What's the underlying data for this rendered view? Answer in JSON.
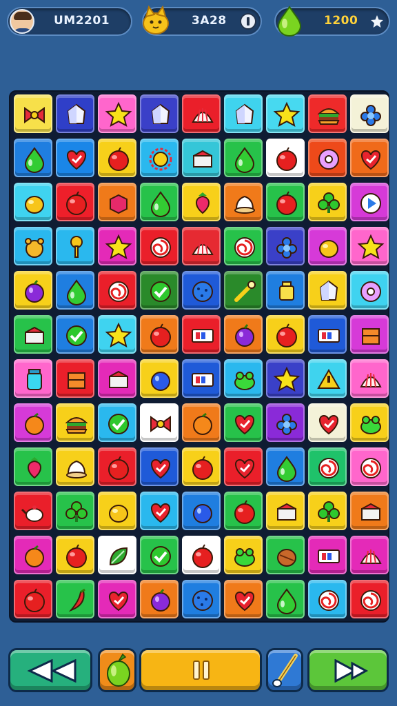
{
  "hud": {
    "player_name": "UM2201",
    "coins": "3A28",
    "gems": "1200"
  },
  "board": {
    "rows": 12,
    "cols": 9,
    "tiles": [
      [
        "#f7e04a:bow",
        "#2f3fc8:gem",
        "#ff66cc:star",
        "#3a40c8:gem",
        "#ea1f2a:shell",
        "#3fd3ee:gem",
        "#47d9f0:star",
        "#ee2a2a:burger",
        "#f4f2d8:flower"
      ],
      [
        "#1f7ee0:drop",
        "#1a86e8:heart",
        "#f7d01a:flag",
        "#2ab8ee:sun",
        "#35c6d8:cake",
        "#27c24a:drop",
        "#ffffff:apple",
        "#ee4a1a:donut",
        "#f06a1a:heart"
      ],
      [
        "#3fd3f0:lemon",
        "#ee1f2a:apple",
        "#f07a1a:candy",
        "#27c24a:drop",
        "#f7d01a:berry",
        "#f07a1a:cream",
        "#27c24a:apple",
        "#f7d01a:clover",
        "#d63ad8:arrow"
      ],
      [
        "#2ab8ee:bear",
        "#2ab8ee:key",
        "#e42ab8:star",
        "#ea1f2a:swirl",
        "#e62a32:shell",
        "#27c24a:swirl",
        "#3a40c8:flower",
        "#d63ad8:lemon",
        "#ff66cc:star"
      ],
      [
        "#f7d01a:plum",
        "#1f7ee0:drop",
        "#ea1f2a:swirl",
        "#2a8a2a:check",
        "#1f5ad8:cookie",
        "#2a8a2a:wand",
        "#1f7ee0:pot",
        "#f7d01a:gem",
        "#3fd3f0:donut"
      ],
      [
        "#27c24a:cake",
        "#1f7ee0:check",
        "#3fd3f0:star",
        "#f07a1a:apple",
        "#ea1f2a:card",
        "#f07a1a:plum",
        "#f7d01a:apple",
        "#1f5ad8:card",
        "#d63ad8:box"
      ],
      [
        "#ff66cc:jar",
        "#ea1f2a:box",
        "#e42ab8:cake",
        "#f7d01a:blueberry",
        "#1f5ad8:card",
        "#2ab8ee:frog",
        "#3a40c8:star",
        "#3fd3ee:warn",
        "#ff66cc:shell"
      ],
      [
        "#d63ad8:orange",
        "#f7d01a:burger",
        "#2ab8ee:check",
        "#ffffff:bow",
        "#f07a1a:orange",
        "#27c24a:heart",
        "#8a2ad8:flower",
        "#f4f2d8:heart",
        "#f7d01a:frog"
      ],
      [
        "#27c24a:berry",
        "#f7d01a:cream",
        "#ea1f2a:apple",
        "#1f5ad8:heart",
        "#f7d01a:apple",
        "#ea1f2a:heart",
        "#1f7ee0:drop",
        "#1fc26a:swirl",
        "#ff66cc:swirl"
      ],
      [
        "#ea1f2a:teapot",
        "#27c24a:clover",
        "#f7d01a:lemon",
        "#2ab8ee:heart",
        "#1f7ee0:blueberry",
        "#27c24a:apple",
        "#f7d01a:cake",
        "#f7d01a:clover",
        "#f07a1a:cake"
      ],
      [
        "#e42ab8:orange",
        "#f7d01a:apple",
        "#ffffff:leaf",
        "#27c24a:check",
        "#ffffff:apple",
        "#f7d01a:frog",
        "#27c24a:nut",
        "#e42ab8:card",
        "#e42ab8:shell"
      ],
      [
        "#ea1f2a:apple",
        "#27c24a:pepper",
        "#e42ab8:heart",
        "#f07a1a:plum",
        "#1f7ee0:cookie",
        "#f07a1a:heart",
        "#27c24a:drop",
        "#2ab8ee:swirl",
        "#ea1f2a:swirl"
      ]
    ]
  },
  "icons": {
    "coin": "cat-coin-icon",
    "gem": "green-drop-gem-icon",
    "add": "add-icon",
    "info": "info-icon",
    "back": "rewind-icon",
    "booster": "vegetable-booster-icon",
    "pause": "pause-icon",
    "brush": "brush-icon",
    "next": "forward-icon"
  }
}
